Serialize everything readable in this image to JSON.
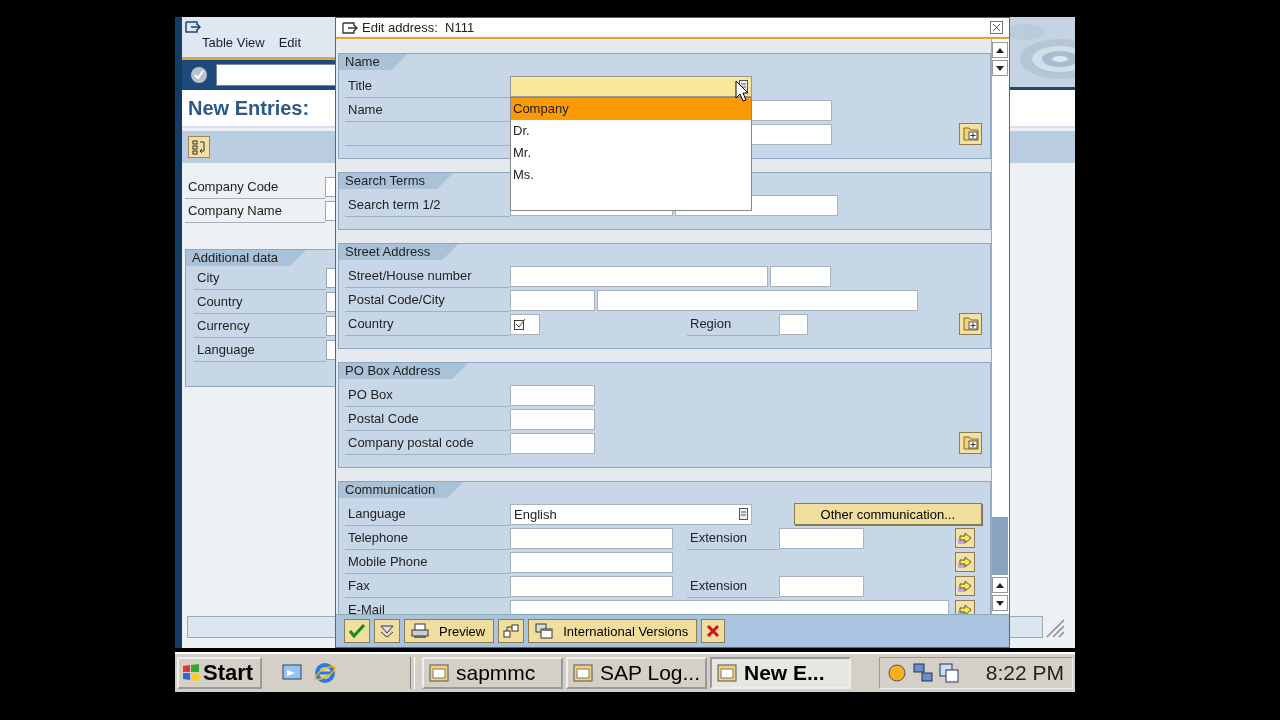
{
  "main_window": {
    "menu": [
      "Table View",
      "Edit"
    ],
    "title": "New Entries:",
    "fields": [
      {
        "label": "Company Code"
      },
      {
        "label": "Company Name"
      }
    ],
    "group": {
      "title": "Additional data",
      "fields": [
        {
          "label": "City"
        },
        {
          "label": "Country"
        },
        {
          "label": "Currency"
        },
        {
          "label": "Language"
        }
      ]
    }
  },
  "dialog": {
    "title": "Edit address:  N111",
    "sections": [
      {
        "title": "Name",
        "rows": [
          {
            "label": "Title",
            "inputs": [
              {
                "kind": "select",
                "expanded": true,
                "options": [
                  {
                    "label": "Company",
                    "selected": true
                  },
                  {
                    "label": "Dr.",
                    "selected": false
                  },
                  {
                    "label": "Mr.",
                    "selected": false
                  },
                  {
                    "label": "Ms.",
                    "selected": false
                  }
                ]
              }
            ]
          },
          {
            "label": "Name",
            "inputs": [
              {
                "kind": "name"
              }
            ]
          },
          {
            "inputs": [
              {
                "kind": "name"
              }
            ],
            "action": {
              "kind": "details"
            }
          }
        ]
      },
      {
        "title": "Search Terms",
        "rows": [
          {
            "label": "Search term 1/2",
            "inputs": [
              {
                "kind": "medium"
              },
              {
                "kind": "medium"
              }
            ]
          }
        ]
      },
      {
        "title": "Street Address",
        "rows": [
          {
            "label": "Street/House number",
            "inputs": [
              {
                "kind": "long"
              },
              {
                "kind": "short"
              }
            ]
          },
          {
            "label": "Postal Code/City",
            "inputs": [
              {
                "kind": "code"
              },
              {
                "kind": "city"
              }
            ]
          },
          {
            "label": "Country",
            "inputs": [
              {
                "kind": "checkmark"
              }
            ],
            "label2": "Region",
            "inputs2": [
              {
                "kind": "tiny"
              }
            ],
            "action": {
              "kind": "details"
            }
          }
        ]
      },
      {
        "title": "PO Box Address",
        "rows": [
          {
            "label": "PO Box",
            "inputs": [
              {
                "kind": "code"
              }
            ]
          },
          {
            "label": "Postal Code",
            "inputs": [
              {
                "kind": "code"
              }
            ]
          },
          {
            "label": "Company postal code",
            "inputs": [
              {
                "kind": "code"
              }
            ],
            "action": {
              "kind": "details"
            }
          }
        ]
      },
      {
        "title": "Communication",
        "rows": [
          {
            "label": "Language",
            "inputs": [
              {
                "kind": "select",
                "value": "English",
                "expanded": false
              }
            ],
            "action": {
              "kind": "button",
              "label": "Other communication..."
            }
          },
          {
            "label": "Telephone",
            "inputs": [
              {
                "kind": "medium"
              }
            ],
            "label2": "Extension",
            "inputs2": [
              {
                "kind": "code"
              }
            ],
            "action": {
              "kind": "arrow"
            }
          },
          {
            "label": "Mobile Phone",
            "inputs": [
              {
                "kind": "medium"
              }
            ],
            "action": {
              "kind": "arrow"
            }
          },
          {
            "label": "Fax",
            "inputs": [
              {
                "kind": "medium"
              }
            ],
            "label2": "Extension",
            "inputs2": [
              {
                "kind": "code"
              }
            ],
            "action": {
              "kind": "arrow"
            }
          },
          {
            "label": "E-Mail",
            "inputs": [
              {
                "kind": "email"
              }
            ],
            "action": {
              "kind": "arrow"
            }
          }
        ]
      }
    ],
    "toolbar": [
      {
        "kind": "icon"
      },
      {
        "kind": "icon"
      },
      {
        "kind": "text",
        "label": "Preview"
      },
      {
        "kind": "icon"
      },
      {
        "kind": "text",
        "label": "International Versions"
      },
      {
        "kind": "icon"
      }
    ]
  },
  "taskbar": {
    "start": "Start",
    "tasks": [
      {
        "label": "sapmmc",
        "selected": false
      },
      {
        "label": "SAP Log...",
        "selected": false
      },
      {
        "label": "New E...",
        "selected": true
      }
    ],
    "clock": "8:22 PM"
  }
}
